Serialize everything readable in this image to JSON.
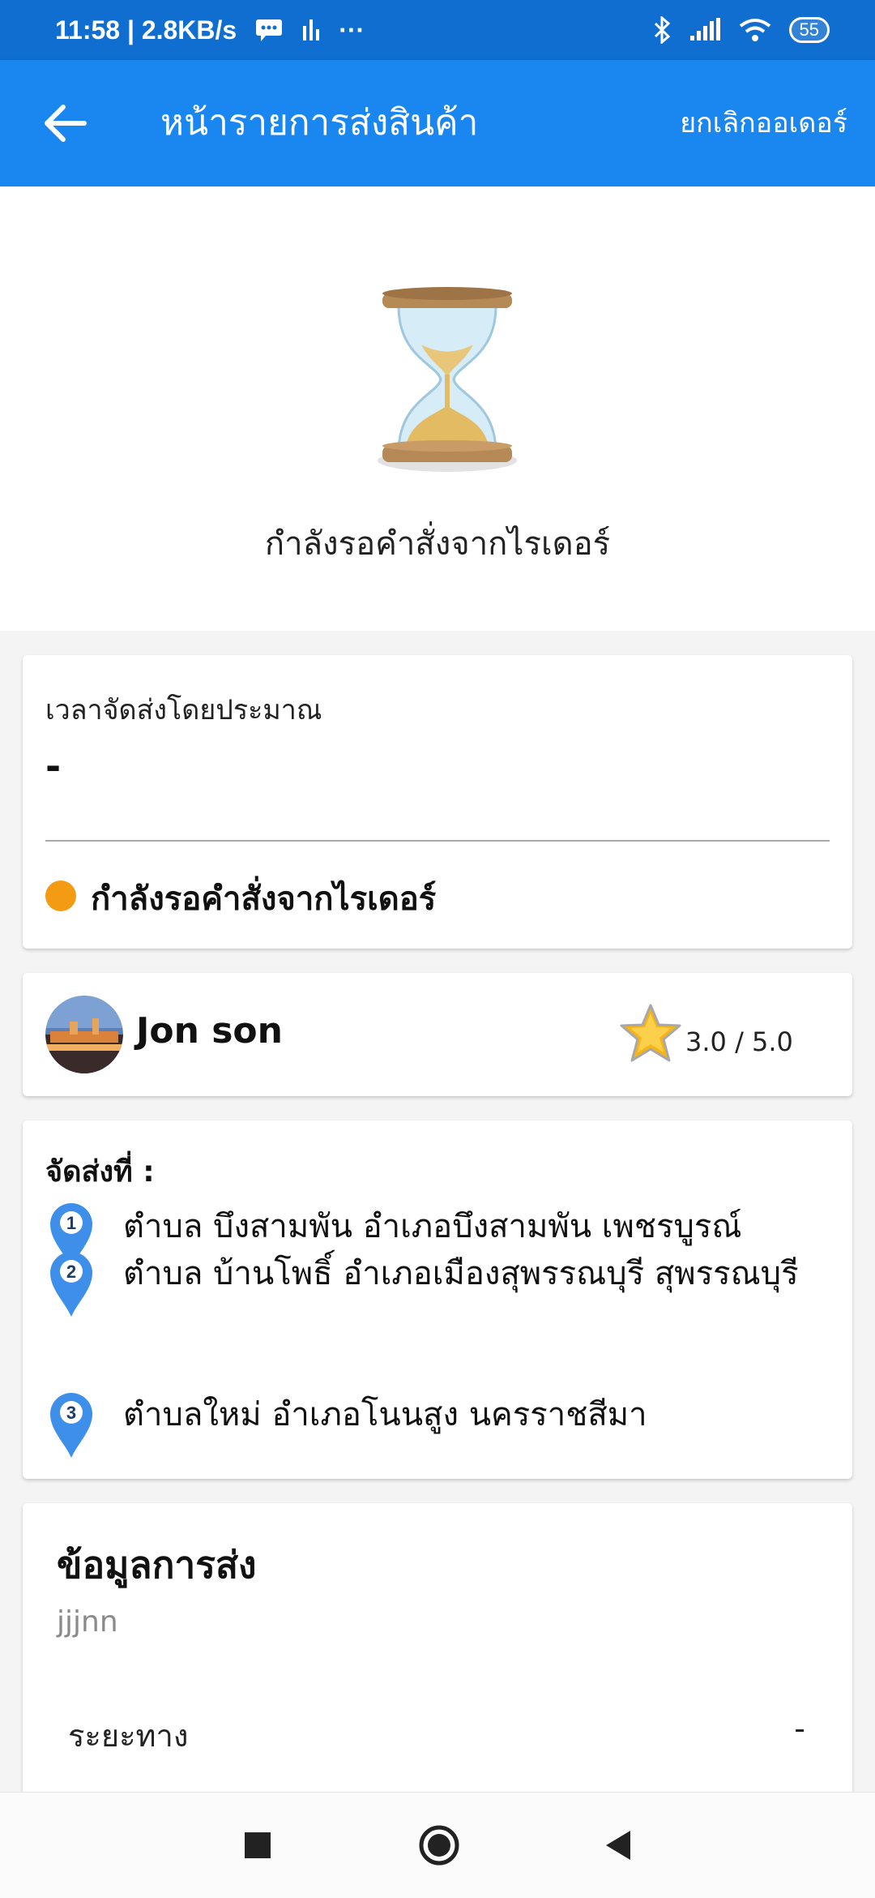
{
  "status_bar": {
    "time_speed": "11:58 | 2.8KB/s",
    "more": "···",
    "battery": "55"
  },
  "app_bar": {
    "title": "หน้ารายการส่งสินค้า",
    "cancel_label": "ยกเลิกออเดอร์"
  },
  "hero": {
    "message": "กำลังรอคำสั่งจากไรเดอร์"
  },
  "eta_card": {
    "label": "เวลาจัดส่งโดยประมาณ",
    "value": "-",
    "status_text": "กำลังรอคำสั่งจากไรเดอร์",
    "status_color": "#f39b12"
  },
  "driver": {
    "name": "Jon son",
    "rating": "3.0 / 5.0"
  },
  "destinations": {
    "label": "จัดส่งที่ :",
    "items": [
      {
        "number": "1",
        "text": "ตำบล บึงสามพัน อำเภอบึงสามพัน เพชรบูรณ์"
      },
      {
        "number": "2",
        "text": "ตำบล บ้านโพธิ์ อำเภอเมืองสุพรรณบุรี สุพรรณบุรี"
      },
      {
        "number": "3",
        "text": "ตำบลใหม่ อำเภอโนนสูง นครราชสีมา"
      }
    ]
  },
  "delivery_info": {
    "title": "ข้อมูลการส่ง",
    "note": "jjjnn",
    "distance_label": "ระยะทาง",
    "distance_value": "-"
  },
  "colors": {
    "app_bar": "#1a86f0",
    "status_bar": "#0f6ecf",
    "pin": "#3d8fea"
  }
}
